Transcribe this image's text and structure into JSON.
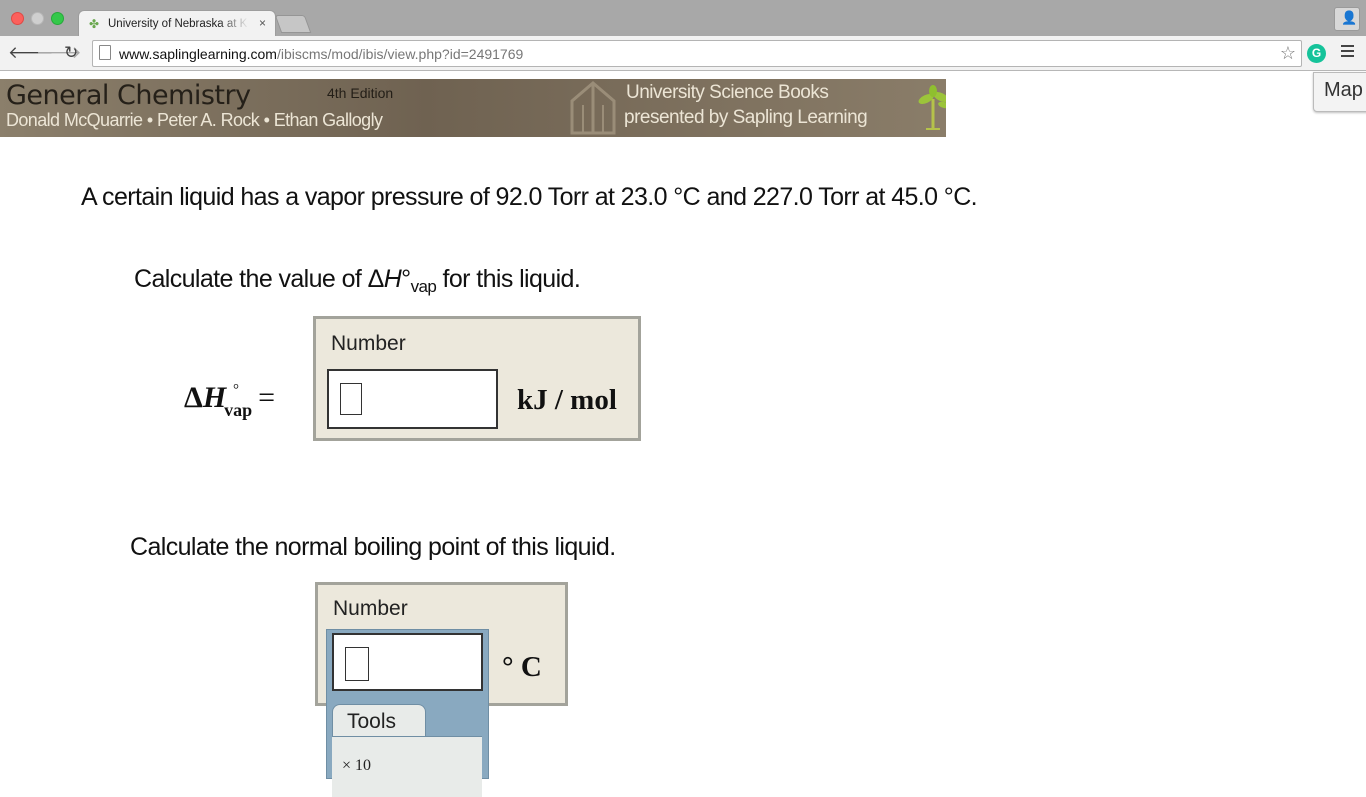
{
  "browser": {
    "tab_title": "University of Nebraska at Ke",
    "tab_close": "×",
    "url_host": "www.saplinglearning.com",
    "url_path": "/ibiscms/mod/ibis/view.php?id=2491769",
    "extension_letter": "G"
  },
  "banner": {
    "title": "General Chemistry",
    "edition": "4th Edition",
    "authors": "Donald McQuarrie • Peter A. Rock • Ethan Gallogly",
    "publisher": "University Science Books",
    "presented_by": "presented by Sapling Learning"
  },
  "map_tab": {
    "label": "Map"
  },
  "question": {
    "text": "A certain liquid has a vapor pressure of 92.0 Torr at 23.0 °C and 227.0 Torr at 45.0 °C.",
    "part1_prefix": "Calculate the value of Δ",
    "part1_h": "H",
    "part1_deg": "°",
    "part1_sub": "vap",
    "part1_suffix": " for this liquid.",
    "part2": "Calculate the normal boiling point of this liquid."
  },
  "answer1": {
    "label_delta": "Δ",
    "label_h": "H",
    "label_deg": "°",
    "label_sub": "vap",
    "label_eq": "=",
    "box_title": "Number",
    "value": "",
    "unit": "kJ / mol"
  },
  "answer2": {
    "box_title": "Number",
    "value": "",
    "unit": "° C",
    "tools_label": "Tools",
    "tools_item": "× 10"
  }
}
